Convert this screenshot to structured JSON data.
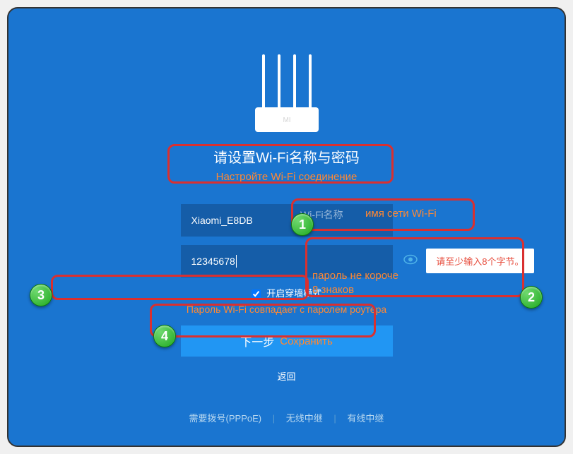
{
  "header": {
    "title": "请设置Wi-Fi名称与密码",
    "subtitle": "Настройте Wi-Fi соединение"
  },
  "wifi_name": {
    "value": "Xiaomi_E8DB",
    "placeholder_label": "Wi-Fi名称",
    "annotation": "имя сети Wi-Fi"
  },
  "wifi_password": {
    "value": "12345678",
    "error": "请至少输入8个字节。",
    "annotation_line1": "пароль не короче",
    "annotation_line2": "8 знаков"
  },
  "checkbox": {
    "label": "开启穿墙模式",
    "checked": true
  },
  "same_password_note": "Пароль Wi-Fi совпадает с паролем роутера",
  "next_button": {
    "label": "下一步",
    "save_label": "Сохранить"
  },
  "back_link": "返回",
  "footer": {
    "pppoe": "需要拨号(PPPoE)",
    "wireless": "无线中继",
    "wired": "有线中继"
  },
  "badges": {
    "b1": "1",
    "b2": "2",
    "b3": "3",
    "b4": "4"
  }
}
